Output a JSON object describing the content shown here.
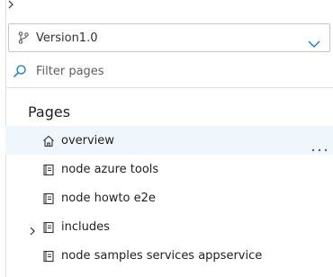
{
  "branch": {
    "label": "Version1.0"
  },
  "filter": {
    "placeholder": "Filter pages"
  },
  "pages": {
    "title": "Pages",
    "items": [
      {
        "label": "overview",
        "icon": "home-icon",
        "selected": true,
        "expandable": false
      },
      {
        "label": "node azure tools",
        "icon": "page-icon",
        "selected": false,
        "expandable": false
      },
      {
        "label": "node howto e2e",
        "icon": "page-icon",
        "selected": false,
        "expandable": false
      },
      {
        "label": "includes",
        "icon": "page-icon",
        "selected": false,
        "expandable": true
      },
      {
        "label": "node samples services appservice",
        "icon": "page-icon",
        "selected": false,
        "expandable": false
      }
    ]
  },
  "colors": {
    "accent": "#0078d4",
    "selected_bg": "#eff6fc",
    "border": "#c8c6c4"
  }
}
